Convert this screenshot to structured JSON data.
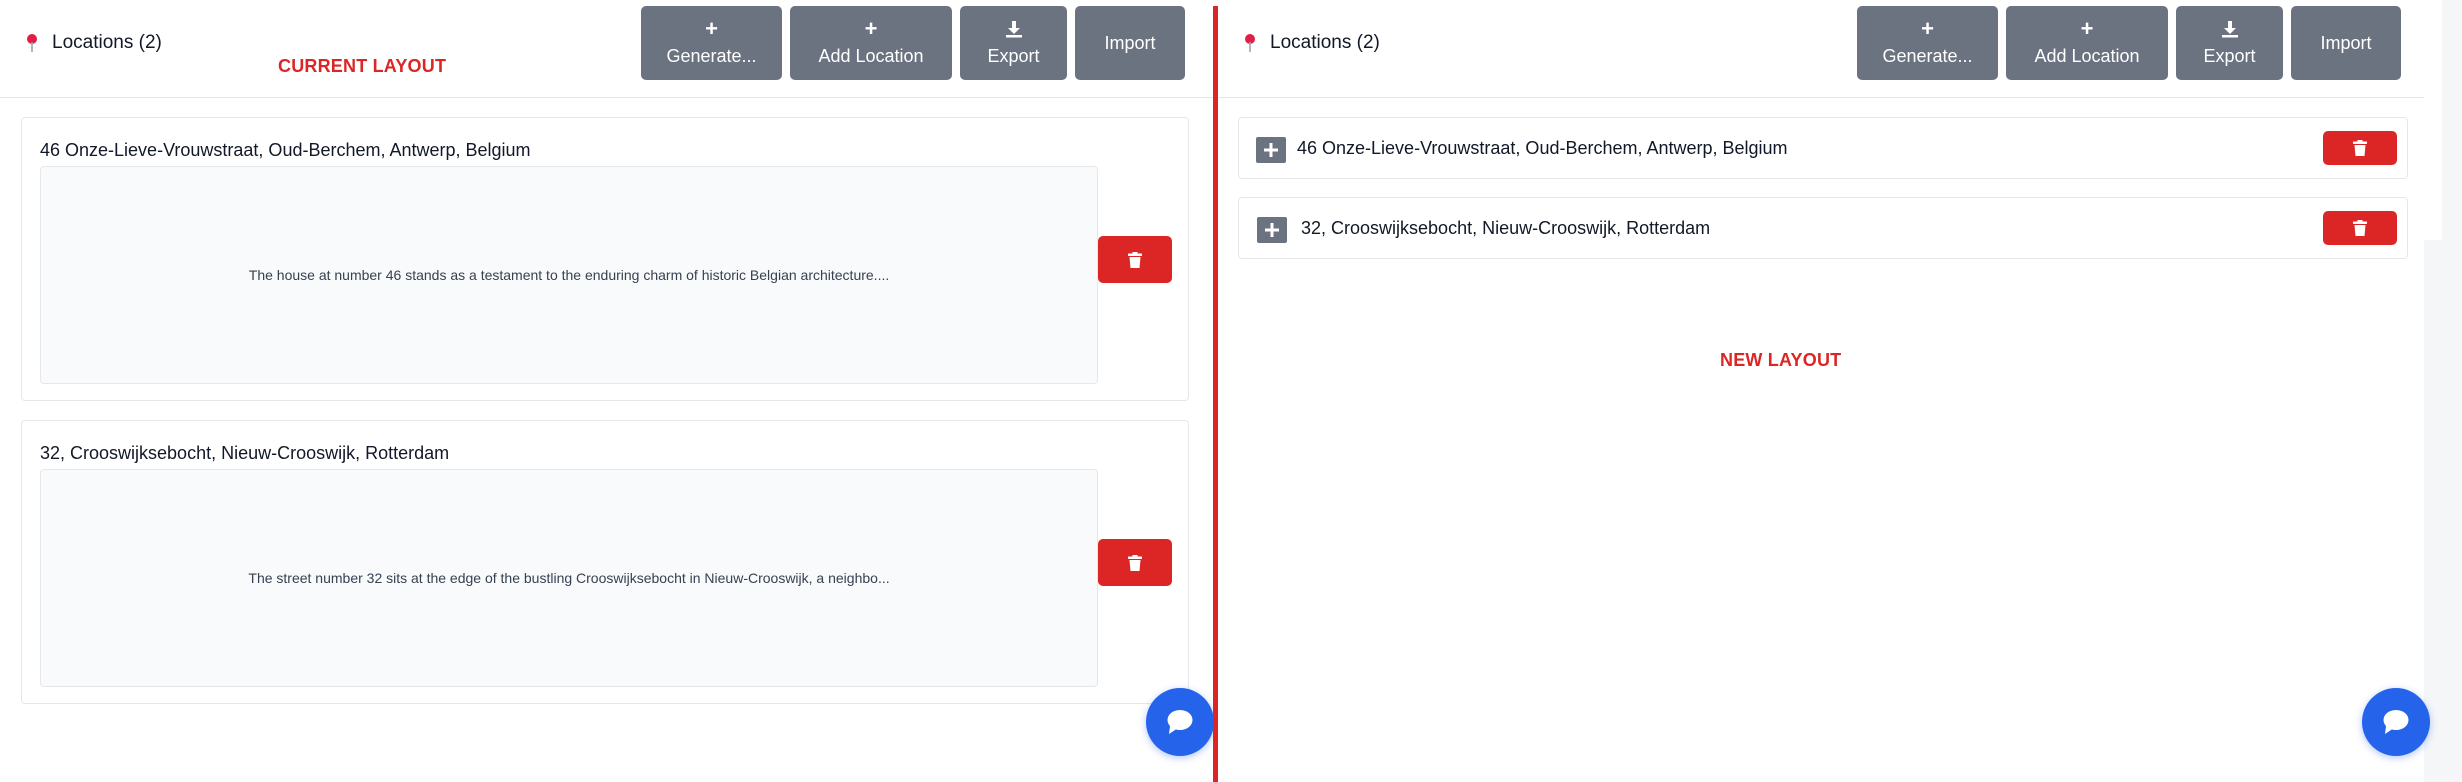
{
  "current_layout": {
    "label": "CURRENT LAYOUT",
    "header": {
      "title": "Locations (2)"
    },
    "toolbar": {
      "generate_label": "Generate...",
      "add_location_label": "Add Location",
      "export_label": "Export",
      "import_label": "Import"
    },
    "locations": [
      {
        "title": "46 Onze-Lieve-Vrouwstraat, Oud-Berchem, Antwerp, Belgium",
        "description": "The house at number 46 stands as a testament to the enduring charm of historic Belgian architecture...."
      },
      {
        "title": "32, Crooswijksebocht, Nieuw-Crooswijk, Rotterdam",
        "description": "The street number 32 sits at the edge of the bustling Crooswijksebocht in Nieuw-Crooswijk, a neighbo..."
      }
    ]
  },
  "new_layout": {
    "label": "NEW LAYOUT",
    "header": {
      "title": "Locations (2)"
    },
    "toolbar": {
      "generate_label": "Generate...",
      "add_location_label": "Add Location",
      "export_label": "Export",
      "import_label": "Import"
    },
    "locations": [
      {
        "title": "46 Onze-Lieve-Vrouwstraat, Oud-Berchem, Antwerp, Belgium"
      },
      {
        "title": "32, Crooswijksebocht, Nieuw-Crooswijk, Rotterdam"
      }
    ]
  },
  "icons": {
    "pin": "map-pin-icon",
    "plus": "plus-icon",
    "download": "download-icon",
    "trash": "trash-icon",
    "chat": "chat-bubble-icon"
  },
  "colors": {
    "accent_red": "#dc2626",
    "pin_pink": "#e11d48",
    "button_gray": "#6b7280",
    "chat_blue": "#2563eb"
  }
}
